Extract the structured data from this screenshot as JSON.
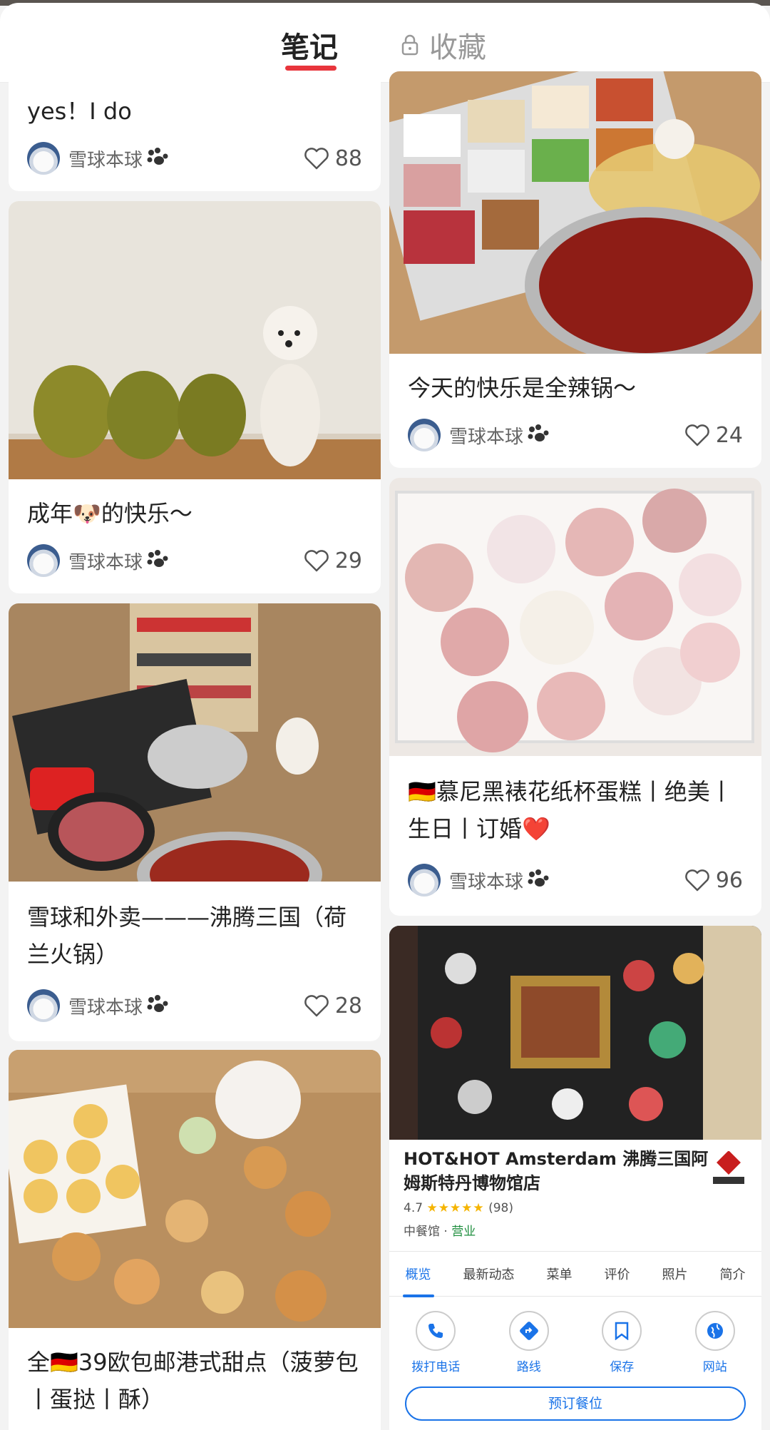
{
  "header": {
    "tab_notes": "笔记",
    "tab_favorites": "收藏"
  },
  "author": "雪球本球",
  "left_column": [
    {
      "title": "yes！I do",
      "likes": "88",
      "photo": "none"
    },
    {
      "title": "成年🐶的快乐～",
      "likes": "29",
      "photo": "durians-and-white-poodle"
    },
    {
      "title": "雪球和外卖———沸腾三国（荷兰火锅）",
      "likes": "28",
      "photo": "hotpot-spread-on-floor"
    },
    {
      "title": "全🇩🇪39欧包邮港式甜点（菠萝包丨蛋挞丨酥）",
      "likes": "",
      "photo": "pastries-with-poodle"
    }
  ],
  "right_column": [
    {
      "title": "今天的快乐是全辣锅～",
      "likes": "24",
      "photo": "spicy-hotpot-with-dishes"
    },
    {
      "title": "🇩🇪慕尼黑裱花纸杯蛋糕丨绝美丨生日丨订婚❤️",
      "likes": "96",
      "photo": "box-of-rose-cupcakes"
    }
  ],
  "map_card": {
    "name": "HOT&HOT Amsterdam 沸腾三国阿姆斯特丹博物馆店",
    "rating": "4.7",
    "stars": "★★★★★",
    "review_count": "(98)",
    "category": "中餐馆",
    "status": "营业",
    "tabs": [
      "概览",
      "最新动态",
      "菜单",
      "评价",
      "照片",
      "简介"
    ],
    "actions": [
      "拨打电话",
      "路线",
      "保存",
      "网站"
    ],
    "reserve_label": "预订餐位"
  },
  "colors": {
    "accent_red": "#e8353c",
    "map_blue": "#1a73e8",
    "open_green": "#1e8e3e",
    "star_yellow": "#f5b400"
  }
}
